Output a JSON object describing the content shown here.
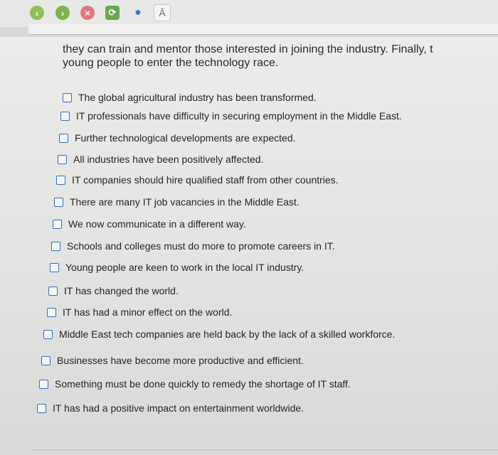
{
  "toolbar": {
    "buttons": [
      {
        "icon": "back-arrow-icon"
      },
      {
        "icon": "forward-arrow-icon"
      },
      {
        "icon": "close-icon"
      },
      {
        "icon": "refresh-icon"
      },
      {
        "icon": "user-icon"
      }
    ],
    "a_label": "Ā"
  },
  "passage": {
    "line1": "they can train and mentor those interested in joining the industry. Finally, t",
    "line2": "young people to enter the technology race."
  },
  "options": [
    {
      "label": "The global agricultural industry has been transformed.",
      "checked": false
    },
    {
      "label": "IT professionals have difficulty in securing employment in the Middle East.",
      "checked": false
    },
    {
      "label": "Further technological developments are expected.",
      "checked": false
    },
    {
      "label": "All industries have been positively affected.",
      "checked": false
    },
    {
      "label": "IT companies should hire qualified staff from other countries.",
      "checked": false
    },
    {
      "label": "There are many IT job vacancies in the Middle East.",
      "checked": false
    },
    {
      "label": "We now communicate in a different way.",
      "checked": false
    },
    {
      "label": "Schools and colleges must do more to promote careers in IT.",
      "checked": false
    },
    {
      "label": "Young people are keen to work in the local IT industry.",
      "checked": false
    },
    {
      "label": "IT has changed the world.",
      "checked": false
    },
    {
      "label": "IT has had a minor effect on the world.",
      "checked": false
    },
    {
      "label": "Middle East tech companies are held back by the lack of a skilled workforce.",
      "checked": false
    },
    {
      "label": "Businesses have become more productive and efficient.",
      "checked": false
    },
    {
      "label": "Something must be done quickly to remedy the shortage of IT staff.",
      "checked": false
    },
    {
      "label": "IT has had a positive impact on entertainment worldwide.",
      "checked": false
    }
  ],
  "colors": {
    "checkbox_border": "#2f6fd0",
    "text": "#262626"
  }
}
